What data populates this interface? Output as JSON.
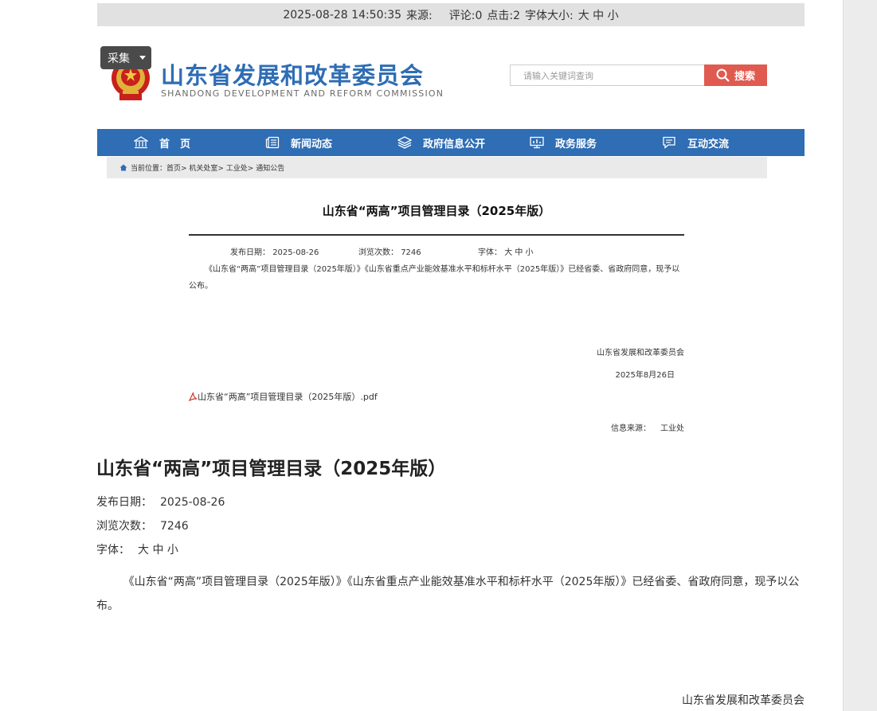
{
  "topbar": {
    "datetime": "2025-08-28 14:50:35",
    "source_label": "来源:",
    "comment_text": "评论:0",
    "clicks_text": "点击:2",
    "font_size_label": "字体大小:",
    "font_size_options": "大 中 小"
  },
  "header": {
    "collect_label": "采集",
    "title": "山东省发展和改革委员会",
    "subtitle": "SHANDONG DEVELOPMENT AND REFORM COMMISSION",
    "search_placeholder": "请输入关键词查询",
    "search_button": "搜索"
  },
  "nav": {
    "items": [
      {
        "label": "首　页",
        "icon": "home-icon"
      },
      {
        "label": "新闻动态",
        "icon": "news-icon"
      },
      {
        "label": "政府信息公开",
        "icon": "layers-icon"
      },
      {
        "label": "政务服务",
        "icon": "chart-icon"
      },
      {
        "label": "互动交流",
        "icon": "chat-icon"
      }
    ]
  },
  "breadcrumb": {
    "text": "当前位置：首页> 机关处室> 工业处> 通知公告"
  },
  "article": {
    "title": "山东省“两高”项目管理目录（2025年版）",
    "publish_label": "发布日期：",
    "publish_date": "2025-08-26",
    "views_label": "浏览次数：",
    "views": "7246",
    "font_label": "字体：",
    "font_options": "大 中 小",
    "body": "《山东省“两高”项目管理目录（2025年版）》《山东省重点产业能效基准水平和标杆水平（2025年版）》已经省委、省政府同意，现予以公布。",
    "sign_org": "山东省发展和改革委员会",
    "sign_date": "2025年8月26日",
    "attachment": "山东省“两高”项目管理目录（2025年版）.pdf",
    "source_label": "信息来源：",
    "source_value": "工业处"
  },
  "plain": {
    "title": "山东省“两高”项目管理目录（2025年版）",
    "publish_label": "发布日期：",
    "publish_date": "2025-08-26",
    "views_label": "浏览次数：",
    "views": "7246",
    "font_label": "字体：",
    "font_options": "大 中 小",
    "body": "《山东省“两高”项目管理目录（2025年版）》《山东省重点产业能效基准水平和标杆水平（2025年版）》已经省委、省政府同意，现予以公布。",
    "sign_org": "山东省发展和改革委员会"
  },
  "colors": {
    "brand_blue": "#2f6db4",
    "search_red": "#e05a50",
    "topbar_gray": "#e1e1e1"
  }
}
